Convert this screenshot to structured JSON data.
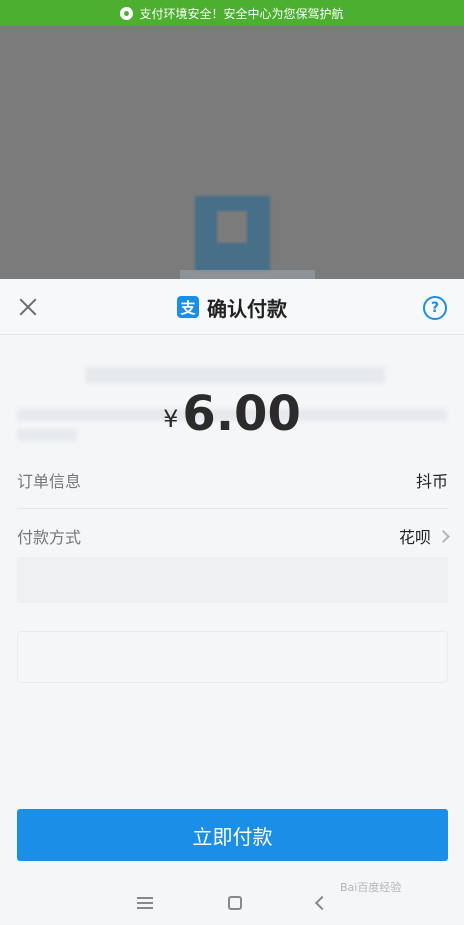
{
  "banner": {
    "text": "支付环境安全！安全中心为您保驾护航",
    "color": "#4caf2f"
  },
  "header": {
    "title": "确认付款",
    "logo_char": "支",
    "help_glyph": "?"
  },
  "payment": {
    "currency_symbol": "¥",
    "amount": "6.00"
  },
  "rows": {
    "order_label": "订单信息",
    "order_value": "抖币",
    "method_label": "付款方式",
    "method_value": "花呗"
  },
  "actions": {
    "pay_label": "立即付款"
  },
  "watermark": "Bai百度经验",
  "colors": {
    "accent": "#1b8fe8",
    "banner": "#4caf2f"
  }
}
